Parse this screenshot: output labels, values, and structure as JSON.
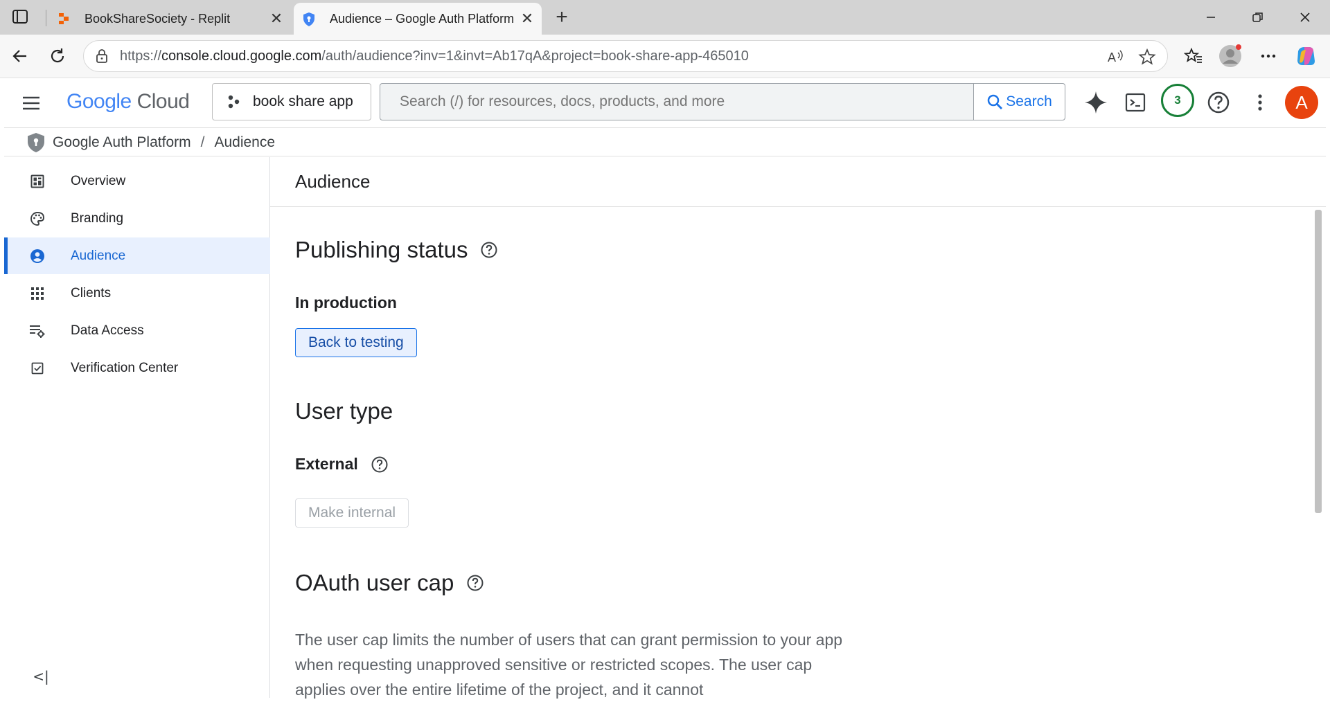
{
  "browser": {
    "tabs": [
      {
        "title": "BookShareSociety - Replit",
        "active": false
      },
      {
        "title": "Audience – Google Auth Platform",
        "active": true
      }
    ],
    "new_tab_symbol": "+",
    "close_symbol": "✕",
    "url_prefix": "https://",
    "url_domain": "console.cloud.google.com",
    "url_path": "/auth/audience?inv=1&invt=Ab17qA&project=book-share-app-465010"
  },
  "header": {
    "logo_google": "Google",
    "logo_cloud": "Cloud",
    "project_name": "book share app",
    "search_placeholder": "Search (/) for resources, docs, products, and more",
    "search_button": "Search",
    "notification_count": "3",
    "avatar_letter": "A"
  },
  "breadcrumb": {
    "items": [
      "Google Auth Platform",
      "Audience"
    ],
    "separator": "/"
  },
  "sidebar": {
    "items": [
      {
        "label": "Overview",
        "icon": "dashboard-icon"
      },
      {
        "label": "Branding",
        "icon": "palette-icon"
      },
      {
        "label": "Audience",
        "icon": "account-circle-icon",
        "active": true
      },
      {
        "label": "Clients",
        "icon": "apps-grid-icon"
      },
      {
        "label": "Data Access",
        "icon": "list-settings-icon"
      },
      {
        "label": "Verification Center",
        "icon": "checkbox-icon"
      }
    ],
    "collapse_symbol": "<|"
  },
  "main": {
    "page_title": "Audience",
    "publishing": {
      "title": "Publishing status",
      "status": "In production",
      "button": "Back to testing"
    },
    "user_type": {
      "title": "User type",
      "value": "External",
      "button": "Make internal"
    },
    "oauth_cap": {
      "title": "OAuth user cap",
      "description": "The user cap limits the number of users that can grant permission to your app when requesting unapproved sensitive or restricted scopes. The user cap applies over the entire lifetime of the project, and it cannot"
    }
  },
  "colors": {
    "accent": "#1a73e8",
    "active_nav_bg": "#e8f0fe",
    "avatar_bg": "#e8430e",
    "badge_green": "#188038"
  }
}
